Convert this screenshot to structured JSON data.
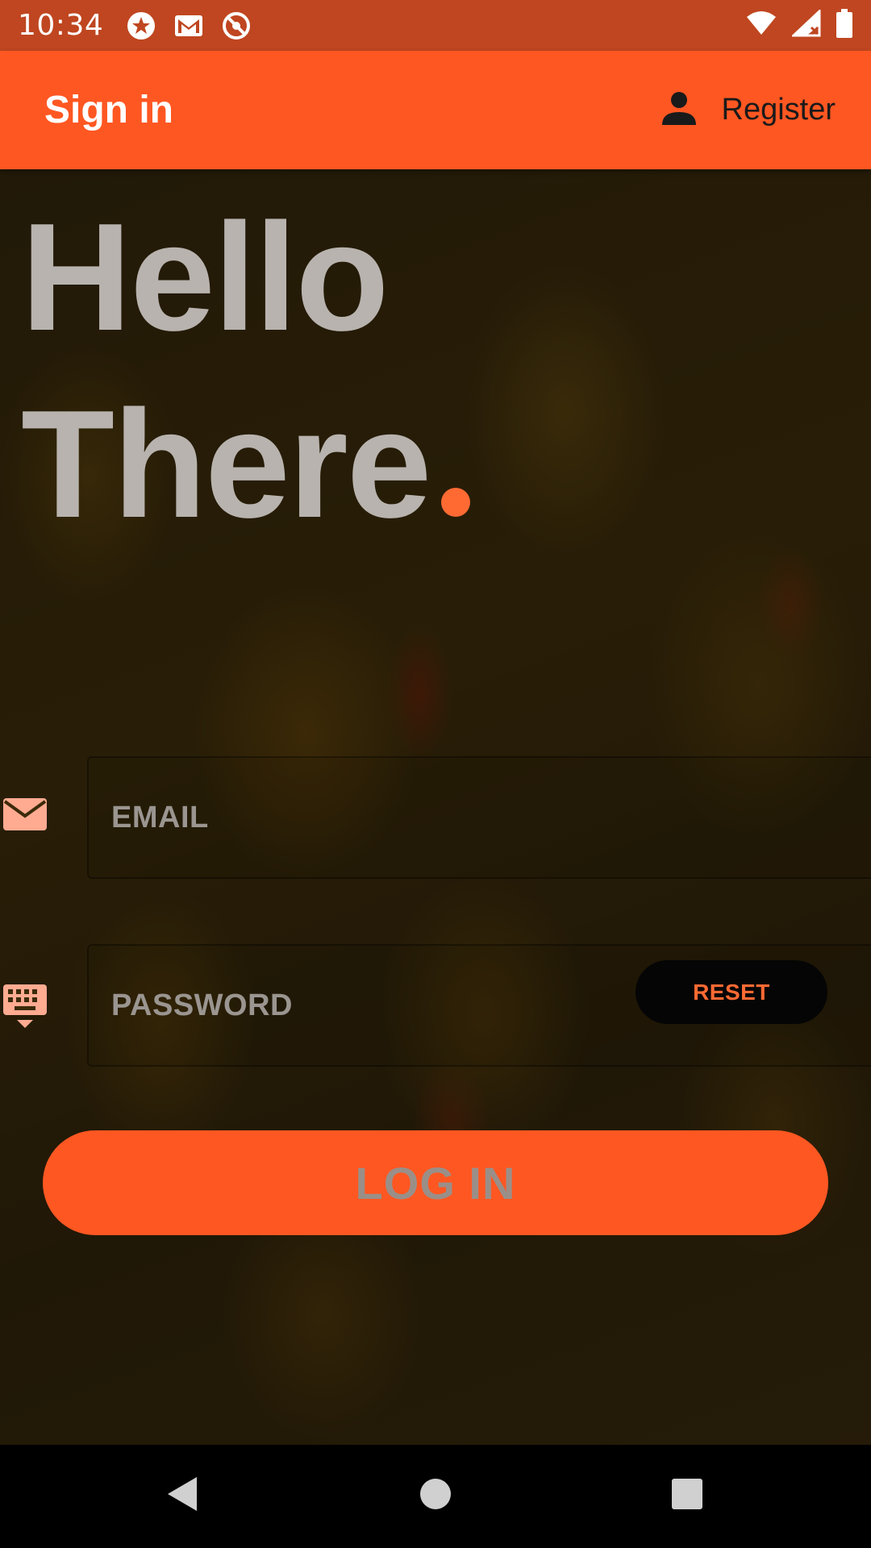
{
  "status_bar": {
    "time": "10:34",
    "left_icons": [
      "star-badge-icon",
      "gmail-icon",
      "no-disturb-icon"
    ],
    "right_icons": [
      "wifi-icon",
      "signal-icon",
      "battery-icon"
    ]
  },
  "app_bar": {
    "title": "Sign in",
    "register_label": "Register",
    "register_icon": "person-icon",
    "color": "#ff5722"
  },
  "hero": {
    "line1": "Hello",
    "line2": "There",
    "accent_color": "#ff6a33"
  },
  "form": {
    "email_placeholder": "EMAIL",
    "email_icon": "envelope-icon",
    "password_placeholder": "PASSWORD",
    "password_icon": "keyboard-icon",
    "reset_label": "RESET",
    "login_label": "LOG IN"
  },
  "nav_bar": {
    "icons": [
      "back-icon",
      "home-icon",
      "recents-icon"
    ]
  }
}
